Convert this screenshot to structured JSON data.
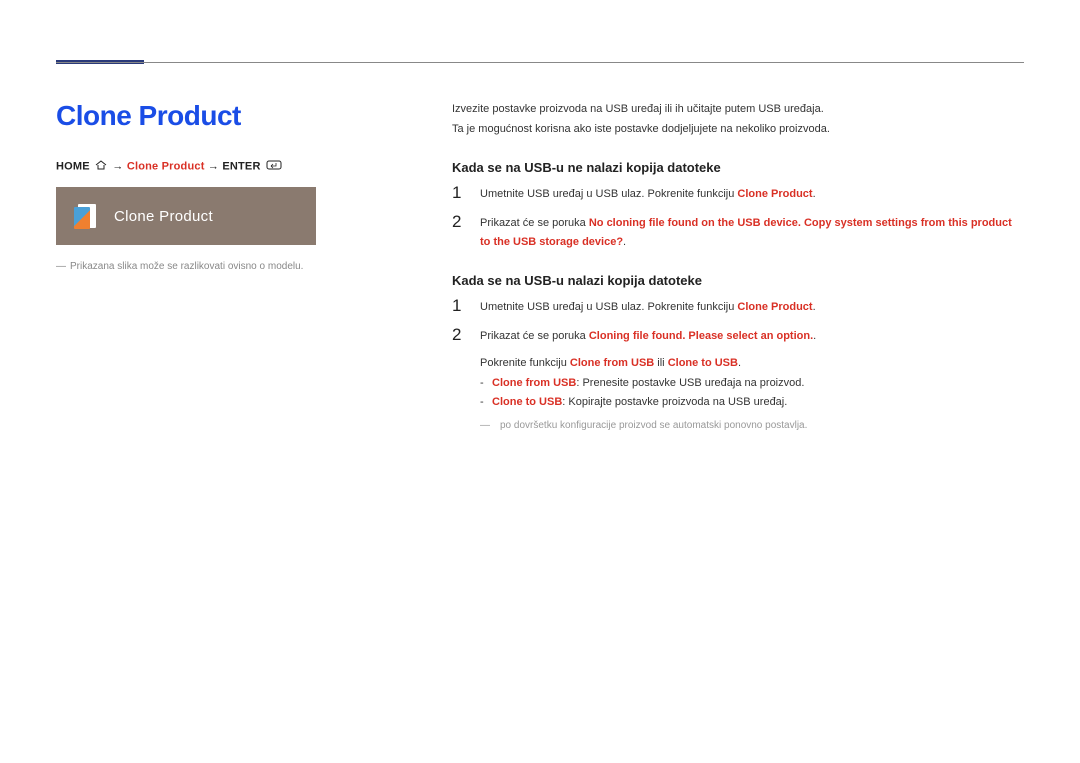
{
  "page": {
    "title": "Clone Product"
  },
  "breadcrumb": {
    "home": "HOME",
    "arrow": "→",
    "clone_product": "Clone Product",
    "enter": "ENTER"
  },
  "ui_mock": {
    "label": "Clone Product"
  },
  "caption": "Prikazana slika može se razlikovati ovisno o modelu.",
  "intro": {
    "line1": "Izvezite postavke proizvoda na USB uređaj ili ih učitajte putem USB uređaja.",
    "line2": "Ta je mogućnost korisna ako iste postavke dodjeljujete na nekoliko proizvoda."
  },
  "section1": {
    "heading": "Kada se na USB-u ne nalazi kopija datoteke",
    "step1_before": "Umetnite USB uređaj u USB ulaz. Pokrenite funkciju ",
    "step1_red": "Clone Product",
    "step1_after": ".",
    "step2_before": "Prikazat će se poruka ",
    "step2_red": "No cloning file found on the USB device. Copy system settings from this product to the USB storage device?",
    "step2_after": "."
  },
  "section2": {
    "heading": "Kada se na USB-u nalazi kopija datoteke",
    "step1_before": "Umetnite USB uređaj u USB ulaz. Pokrenite funkciju ",
    "step1_red": "Clone Product",
    "step1_after": ".",
    "step2_before": "Prikazat će se poruka ",
    "step2_red": "Cloning file found. Please select an option.",
    "step2_after": ".",
    "sub_before": "Pokrenite funkciju ",
    "sub_red1": "Clone from USB",
    "sub_mid": " ili ",
    "sub_red2": "Clone to USB",
    "sub_after": ".",
    "bullet1_red": "Clone from USB",
    "bullet1_after": ": Prenesite postavke USB uređaja na proizvod.",
    "bullet2_red": "Clone to USB",
    "bullet2_after": ": Kopirajte postavke proizvoda na USB uređaj.",
    "note": "po dovršetku konfiguracije proizvod se automatski ponovno postavlja."
  }
}
